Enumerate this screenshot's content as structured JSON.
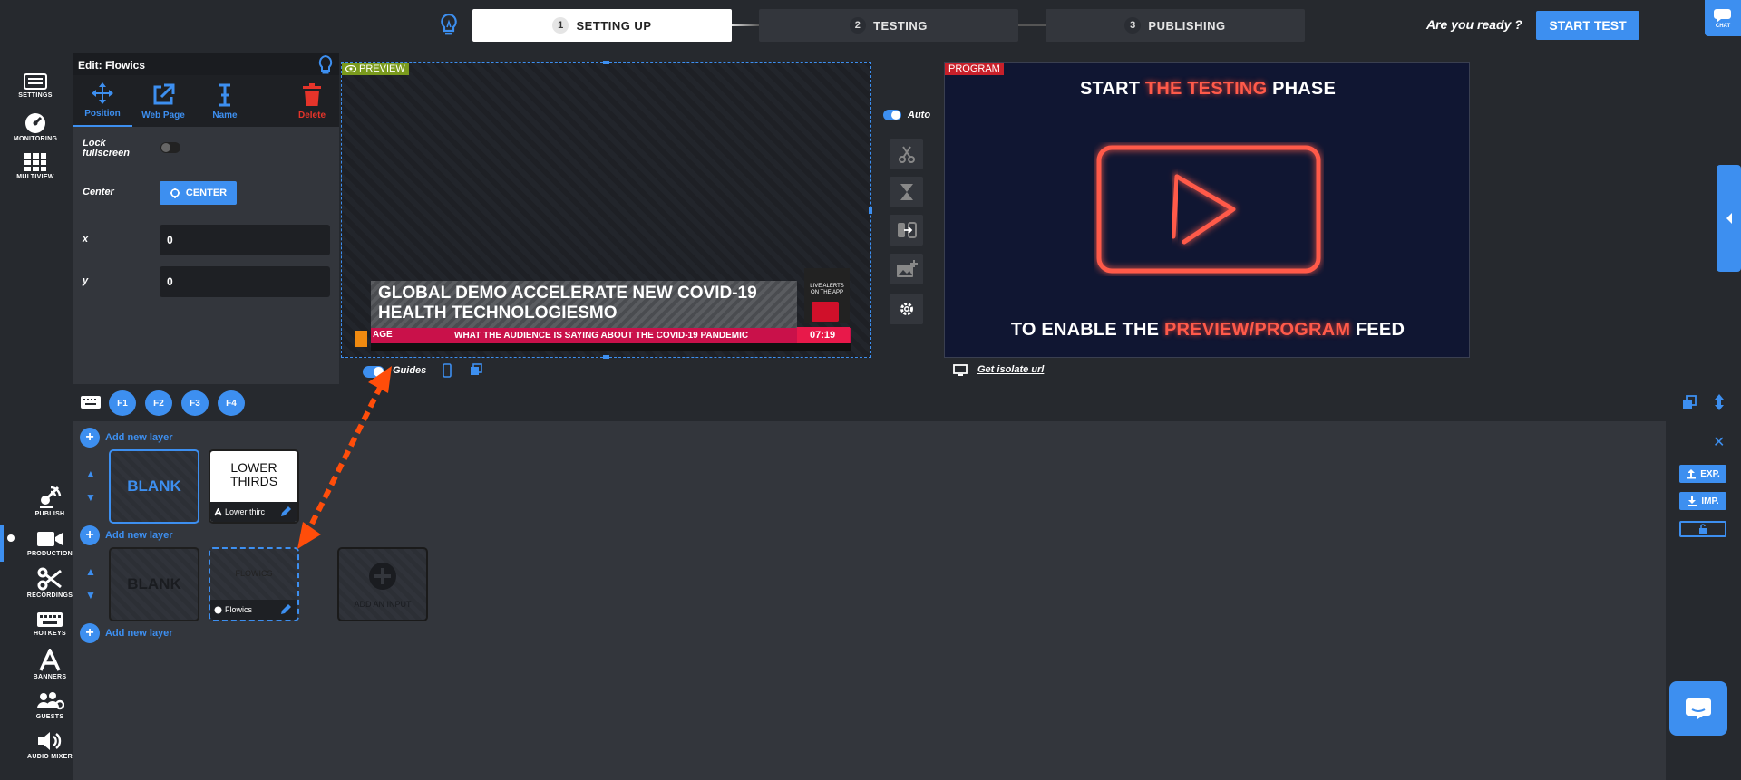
{
  "top": {
    "steps": [
      {
        "num": "1",
        "label": "SETTING UP"
      },
      {
        "num": "2",
        "label": "TESTING"
      },
      {
        "num": "3",
        "label": "PUBLISHING"
      }
    ],
    "ready_text": "Are you ready ?",
    "start_test_label": "START TEST",
    "chat_label": "CHAT"
  },
  "rail": {
    "top_items": [
      "SETTINGS",
      "MONITORING",
      "MULTIVIEW"
    ],
    "bottom_items": [
      "PUBLISH",
      "PRODUCTION",
      "RECORDINGS",
      "HOTKEYS",
      "BANNERS",
      "GUESTS",
      "AUDIO MIXER"
    ],
    "active": "PRODUCTION"
  },
  "edit": {
    "title": "Edit: Flowics",
    "tabs": [
      "Position",
      "Web Page",
      "Name",
      "Delete"
    ],
    "lock_label": "Lock fullscreen",
    "lock_on": false,
    "center_label": "Center",
    "center_button": "CENTER",
    "x_label": "x",
    "x_value": "0",
    "y_label": "y",
    "y_value": "0"
  },
  "preview": {
    "tag": "PREVIEW",
    "headline": "GLOBAL DEMO ACCELERATE NEW COVID-19 HEALTH TECHNOLOGIESMO",
    "ticker": "WHAT THE AUDIENCE IS SAYING ABOUT THE COVID-19 PANDEMIC",
    "ticker_prefix": "AGE",
    "clock": "07:19",
    "live_text": "LIVE ALERTS ON THE APP",
    "guides_label": "Guides",
    "guides_on": true
  },
  "controls": {
    "auto_label": "Auto",
    "auto_on": true
  },
  "program": {
    "tag": "PROGRAM",
    "line1_pre": "START ",
    "line1_hl": "THE TESTING",
    "line1_post": " PHASE",
    "line2_pre": "TO ENABLE THE ",
    "line2_hl": "PREVIEW/PROGRAM",
    "line2_post": " FEED",
    "isolate_link": "Get isolate url"
  },
  "hotkeys": [
    "F1",
    "F2",
    "F3",
    "F4"
  ],
  "layers": {
    "add_label": "Add new layer",
    "row1": {
      "blank": "BLANK",
      "input_title": "LOWER THIRDS",
      "input_name": "Lower thirc"
    },
    "row2": {
      "blank": "BLANK",
      "input_title": "FLOWICS",
      "input_name": "Flowics",
      "add_input": "ADD AN INPUT"
    }
  },
  "right_panel": {
    "export_label": "EXP.",
    "import_label": "IMP."
  },
  "colors": {
    "accent": "#3d8ff0",
    "bg_dark": "#26292e",
    "panel": "#33363c",
    "annotation_arrow": "#ff4d0a",
    "program_red": "#ff5a4a"
  }
}
